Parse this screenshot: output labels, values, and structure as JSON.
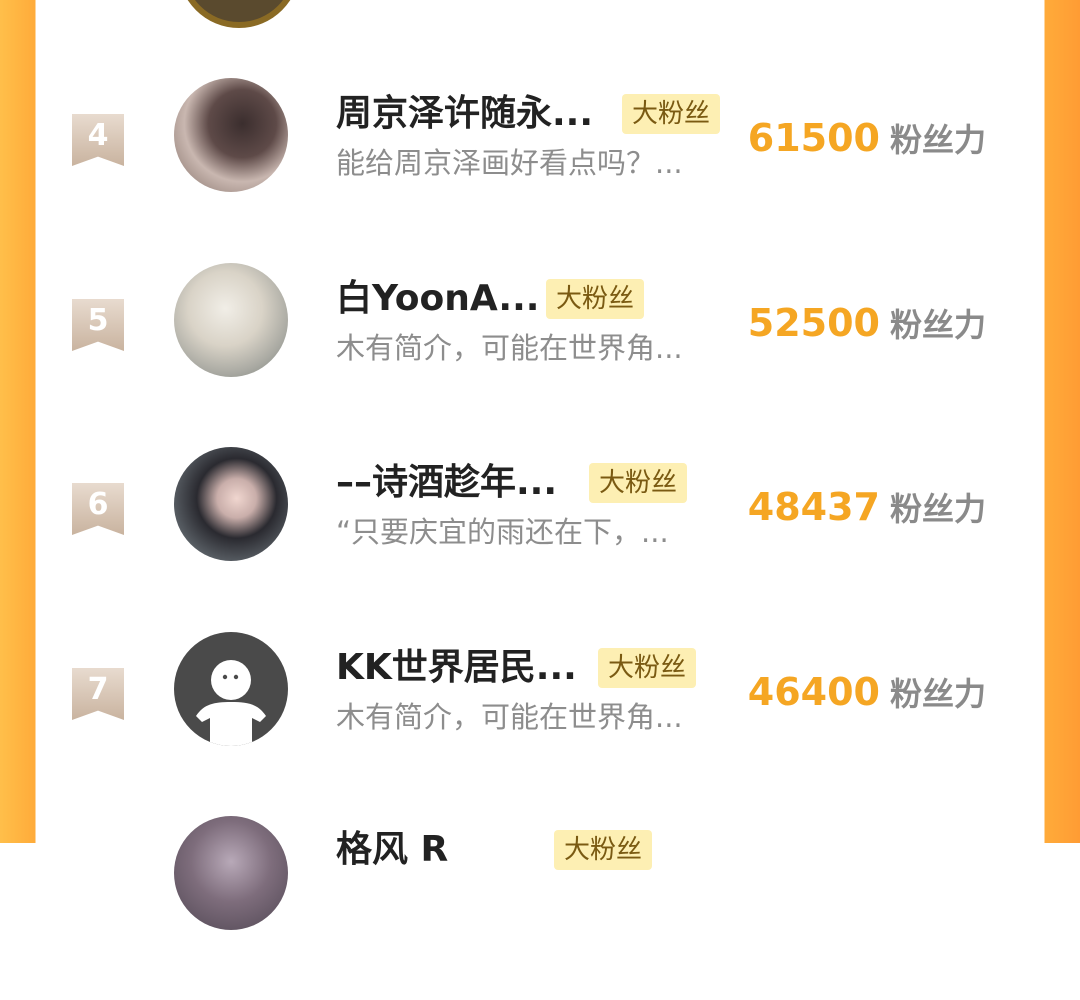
{
  "rows": [
    {
      "rank": "4",
      "name": "周京泽许随永...",
      "badge": "大粉丝",
      "desc": "能给周京泽画好看点吗？...",
      "score": "61500",
      "unit": "粉丝力",
      "avatar": "photo-avatar"
    },
    {
      "rank": "5",
      "name": "白YoonA...",
      "badge": "大粉丝",
      "desc": "木有简介，可能在世界角...",
      "score": "52500",
      "unit": "粉丝力",
      "avatar": "photo-avatar"
    },
    {
      "rank": "6",
      "name": "––诗酒趁年...",
      "badge": "大粉丝",
      "desc": "“只要庆宜的雨还在下，...",
      "score": "48437",
      "unit": "粉丝力",
      "avatar": "photo-avatar"
    },
    {
      "rank": "7",
      "name": "KK世界居民...",
      "badge": "大粉丝",
      "desc": "木有简介，可能在世界角...",
      "score": "46400",
      "unit": "粉丝力",
      "avatar": "default-avatar"
    }
  ],
  "partial_next": {
    "name": "格风 R",
    "badge": "大粉丝"
  },
  "colors": {
    "accent": "#f5a623",
    "badge_bg": "#fdefb3",
    "frame": "#ffab3a",
    "rank": "#c9b39f"
  }
}
